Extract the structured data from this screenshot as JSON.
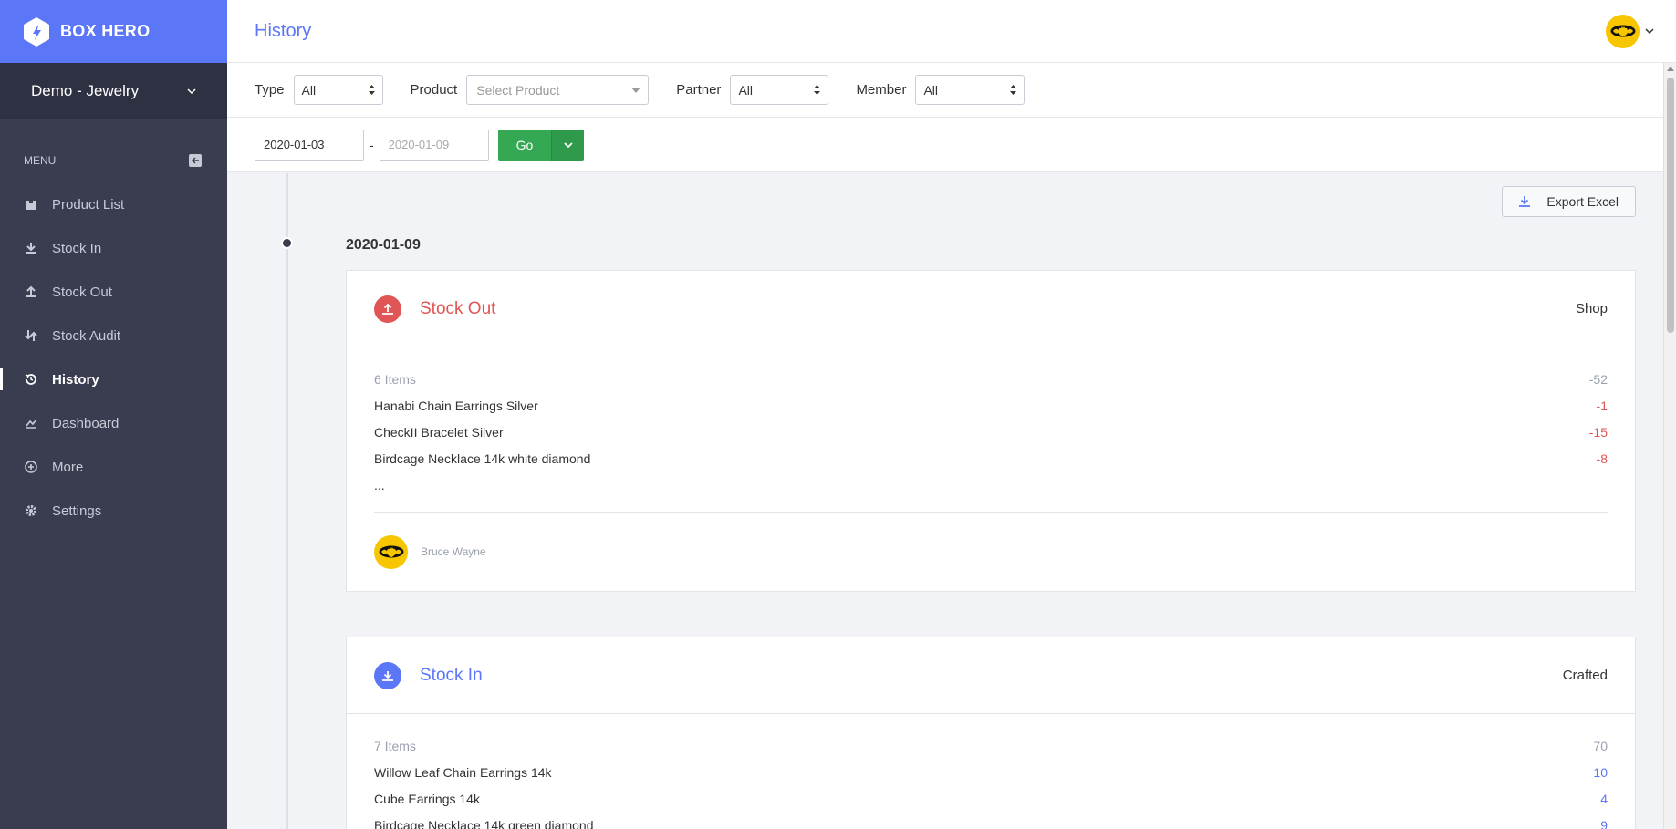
{
  "brand": {
    "name": "BOX HERO",
    "color": "#5b76f7"
  },
  "workspace": {
    "name": "Demo - Jewelry"
  },
  "sidebar": {
    "menu_title": "MENU",
    "items": [
      {
        "label": "Product List",
        "icon": "box-icon"
      },
      {
        "label": "Stock In",
        "icon": "download-icon"
      },
      {
        "label": "Stock Out",
        "icon": "upload-icon"
      },
      {
        "label": "Stock Audit",
        "icon": "audit-icon"
      },
      {
        "label": "History",
        "icon": "history-icon",
        "active": true
      },
      {
        "label": "Dashboard",
        "icon": "chart-icon"
      },
      {
        "label": "More",
        "icon": "plus-circle-icon"
      },
      {
        "label": "Settings",
        "icon": "gear-icon"
      }
    ]
  },
  "header": {
    "title": "History"
  },
  "filters": {
    "type_label": "Type",
    "type_value": "All",
    "product_label": "Product",
    "product_placeholder": "Select Product",
    "partner_label": "Partner",
    "partner_value": "All",
    "member_label": "Member",
    "member_value": "All"
  },
  "date_range": {
    "start": "2020-01-03",
    "separator": "-",
    "end_placeholder": "2020-01-09",
    "go_label": "Go"
  },
  "export_label": "Export Excel",
  "timeline": {
    "date": "2020-01-09",
    "entries": [
      {
        "type": "Stock Out",
        "partner": "Shop",
        "count_label": "6 Items",
        "total": "-52",
        "items": [
          {
            "name": "Hanabi Chain Earrings Silver",
            "qty": "-1"
          },
          {
            "name": "CheckII Bracelet Silver",
            "qty": "-15"
          },
          {
            "name": "Birdcage Necklace 14k white diamond",
            "qty": "-8"
          }
        ],
        "more": "...",
        "member": "Bruce Wayne"
      },
      {
        "type": "Stock In",
        "partner": "Crafted",
        "count_label": "7 Items",
        "total": "70",
        "items": [
          {
            "name": "Willow Leaf Chain Earrings 14k",
            "qty": "10"
          },
          {
            "name": "Cube Earrings 14k",
            "qty": "4"
          },
          {
            "name": "Birdcage Necklace 14k green diamond",
            "qty": "9"
          }
        ]
      }
    ]
  },
  "colors": {
    "stock_out": "#e05555",
    "stock_in": "#5b76f7",
    "go": "#34a853",
    "sidebar": "#3a3d4f"
  }
}
